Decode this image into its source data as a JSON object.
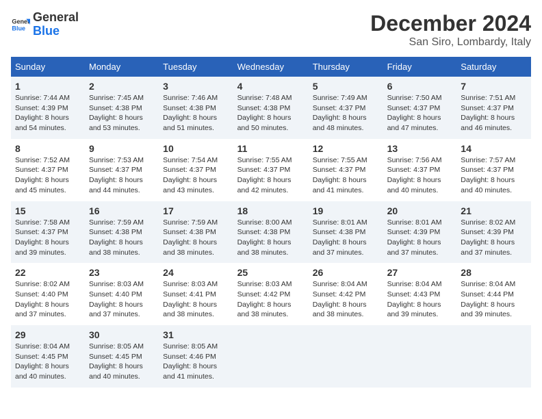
{
  "logo": {
    "line1": "General",
    "line2": "Blue"
  },
  "title": "December 2024",
  "subtitle": "San Siro, Lombardy, Italy",
  "headers": [
    "Sunday",
    "Monday",
    "Tuesday",
    "Wednesday",
    "Thursday",
    "Friday",
    "Saturday"
  ],
  "weeks": [
    [
      {
        "day": "1",
        "sunrise": "Sunrise: 7:44 AM",
        "sunset": "Sunset: 4:39 PM",
        "daylight": "Daylight: 8 hours and 54 minutes."
      },
      {
        "day": "2",
        "sunrise": "Sunrise: 7:45 AM",
        "sunset": "Sunset: 4:38 PM",
        "daylight": "Daylight: 8 hours and 53 minutes."
      },
      {
        "day": "3",
        "sunrise": "Sunrise: 7:46 AM",
        "sunset": "Sunset: 4:38 PM",
        "daylight": "Daylight: 8 hours and 51 minutes."
      },
      {
        "day": "4",
        "sunrise": "Sunrise: 7:48 AM",
        "sunset": "Sunset: 4:38 PM",
        "daylight": "Daylight: 8 hours and 50 minutes."
      },
      {
        "day": "5",
        "sunrise": "Sunrise: 7:49 AM",
        "sunset": "Sunset: 4:37 PM",
        "daylight": "Daylight: 8 hours and 48 minutes."
      },
      {
        "day": "6",
        "sunrise": "Sunrise: 7:50 AM",
        "sunset": "Sunset: 4:37 PM",
        "daylight": "Daylight: 8 hours and 47 minutes."
      },
      {
        "day": "7",
        "sunrise": "Sunrise: 7:51 AM",
        "sunset": "Sunset: 4:37 PM",
        "daylight": "Daylight: 8 hours and 46 minutes."
      }
    ],
    [
      {
        "day": "8",
        "sunrise": "Sunrise: 7:52 AM",
        "sunset": "Sunset: 4:37 PM",
        "daylight": "Daylight: 8 hours and 45 minutes."
      },
      {
        "day": "9",
        "sunrise": "Sunrise: 7:53 AM",
        "sunset": "Sunset: 4:37 PM",
        "daylight": "Daylight: 8 hours and 44 minutes."
      },
      {
        "day": "10",
        "sunrise": "Sunrise: 7:54 AM",
        "sunset": "Sunset: 4:37 PM",
        "daylight": "Daylight: 8 hours and 43 minutes."
      },
      {
        "day": "11",
        "sunrise": "Sunrise: 7:55 AM",
        "sunset": "Sunset: 4:37 PM",
        "daylight": "Daylight: 8 hours and 42 minutes."
      },
      {
        "day": "12",
        "sunrise": "Sunrise: 7:55 AM",
        "sunset": "Sunset: 4:37 PM",
        "daylight": "Daylight: 8 hours and 41 minutes."
      },
      {
        "day": "13",
        "sunrise": "Sunrise: 7:56 AM",
        "sunset": "Sunset: 4:37 PM",
        "daylight": "Daylight: 8 hours and 40 minutes."
      },
      {
        "day": "14",
        "sunrise": "Sunrise: 7:57 AM",
        "sunset": "Sunset: 4:37 PM",
        "daylight": "Daylight: 8 hours and 40 minutes."
      }
    ],
    [
      {
        "day": "15",
        "sunrise": "Sunrise: 7:58 AM",
        "sunset": "Sunset: 4:37 PM",
        "daylight": "Daylight: 8 hours and 39 minutes."
      },
      {
        "day": "16",
        "sunrise": "Sunrise: 7:59 AM",
        "sunset": "Sunset: 4:38 PM",
        "daylight": "Daylight: 8 hours and 38 minutes."
      },
      {
        "day": "17",
        "sunrise": "Sunrise: 7:59 AM",
        "sunset": "Sunset: 4:38 PM",
        "daylight": "Daylight: 8 hours and 38 minutes."
      },
      {
        "day": "18",
        "sunrise": "Sunrise: 8:00 AM",
        "sunset": "Sunset: 4:38 PM",
        "daylight": "Daylight: 8 hours and 38 minutes."
      },
      {
        "day": "19",
        "sunrise": "Sunrise: 8:01 AM",
        "sunset": "Sunset: 4:38 PM",
        "daylight": "Daylight: 8 hours and 37 minutes."
      },
      {
        "day": "20",
        "sunrise": "Sunrise: 8:01 AM",
        "sunset": "Sunset: 4:39 PM",
        "daylight": "Daylight: 8 hours and 37 minutes."
      },
      {
        "day": "21",
        "sunrise": "Sunrise: 8:02 AM",
        "sunset": "Sunset: 4:39 PM",
        "daylight": "Daylight: 8 hours and 37 minutes."
      }
    ],
    [
      {
        "day": "22",
        "sunrise": "Sunrise: 8:02 AM",
        "sunset": "Sunset: 4:40 PM",
        "daylight": "Daylight: 8 hours and 37 minutes."
      },
      {
        "day": "23",
        "sunrise": "Sunrise: 8:03 AM",
        "sunset": "Sunset: 4:40 PM",
        "daylight": "Daylight: 8 hours and 37 minutes."
      },
      {
        "day": "24",
        "sunrise": "Sunrise: 8:03 AM",
        "sunset": "Sunset: 4:41 PM",
        "daylight": "Daylight: 8 hours and 38 minutes."
      },
      {
        "day": "25",
        "sunrise": "Sunrise: 8:03 AM",
        "sunset": "Sunset: 4:42 PM",
        "daylight": "Daylight: 8 hours and 38 minutes."
      },
      {
        "day": "26",
        "sunrise": "Sunrise: 8:04 AM",
        "sunset": "Sunset: 4:42 PM",
        "daylight": "Daylight: 8 hours and 38 minutes."
      },
      {
        "day": "27",
        "sunrise": "Sunrise: 8:04 AM",
        "sunset": "Sunset: 4:43 PM",
        "daylight": "Daylight: 8 hours and 39 minutes."
      },
      {
        "day": "28",
        "sunrise": "Sunrise: 8:04 AM",
        "sunset": "Sunset: 4:44 PM",
        "daylight": "Daylight: 8 hours and 39 minutes."
      }
    ],
    [
      {
        "day": "29",
        "sunrise": "Sunrise: 8:04 AM",
        "sunset": "Sunset: 4:45 PM",
        "daylight": "Daylight: 8 hours and 40 minutes."
      },
      {
        "day": "30",
        "sunrise": "Sunrise: 8:05 AM",
        "sunset": "Sunset: 4:45 PM",
        "daylight": "Daylight: 8 hours and 40 minutes."
      },
      {
        "day": "31",
        "sunrise": "Sunrise: 8:05 AM",
        "sunset": "Sunset: 4:46 PM",
        "daylight": "Daylight: 8 hours and 41 minutes."
      },
      null,
      null,
      null,
      null
    ]
  ]
}
